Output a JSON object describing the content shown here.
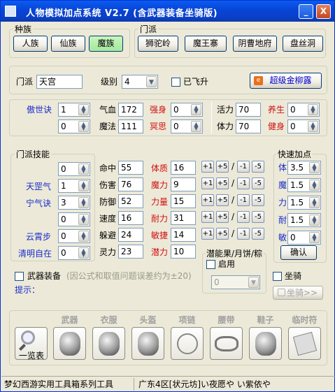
{
  "window": {
    "title": "人物模拟加点系统 V2.7 (含武器装备坐骑版)",
    "min_label": "_",
    "close_label": "X"
  },
  "race": {
    "group_label": "种族",
    "options": [
      "人族",
      "仙族",
      "魔族"
    ],
    "selected": "魔族"
  },
  "sect_top": {
    "group_label": "门派",
    "options": [
      "狮驼岭",
      "魔王寨",
      "阴曹地府",
      "盘丝洞"
    ]
  },
  "info": {
    "sect_label": "门派",
    "sect_value": "天宫",
    "level_label": "级别",
    "level_value": "4",
    "flew_label": "已飞升",
    "super_label": "超级金柳露"
  },
  "skill_top": {
    "name": "傲世诀",
    "value1": "1",
    "value2": "0",
    "arrow": "▲▼"
  },
  "hpmp": {
    "hp_label": "气血",
    "hp_value": "172",
    "mp_label": "魔法",
    "mp_value": "111",
    "strong_label": "强身",
    "strong_value": "0",
    "think_label": "冥思",
    "think_value": "0"
  },
  "vital": {
    "energy_label": "活力",
    "energy_value": "70",
    "stamina_label": "体力",
    "stamina_value": "70",
    "nurture_label": "养生",
    "nurture_value": "0",
    "fitness_label": "健身",
    "fitness_value": "0"
  },
  "sect_skills": {
    "group_label": "门派技能",
    "rows": [
      {
        "name": "",
        "value": "0"
      },
      {
        "name": "天罡气",
        "value": "1"
      },
      {
        "name": "宁气诀",
        "value": "3"
      },
      {
        "name": "",
        "value": "0"
      },
      {
        "name": "云霄步",
        "value": "0"
      },
      {
        "name": "清明自在",
        "value": "0"
      }
    ]
  },
  "stats": {
    "rows": [
      {
        "label": "命中",
        "value": "55",
        "attr": "体质",
        "attr_value": "16"
      },
      {
        "label": "伤害",
        "value": "76",
        "attr": "魔力",
        "attr_value": "9"
      },
      {
        "label": "防御",
        "value": "52",
        "attr": "力量",
        "attr_value": "15"
      },
      {
        "label": "速度",
        "value": "16",
        "attr": "耐力",
        "attr_value": "31"
      },
      {
        "label": "躲避",
        "value": "24",
        "attr": "敏捷",
        "attr_value": "14"
      },
      {
        "label": "灵力",
        "value": "23",
        "attr": "潜力",
        "attr_value": "10"
      }
    ],
    "step_buttons": [
      "+1",
      "+5",
      "-1",
      "-5"
    ],
    "slash": "/"
  },
  "quick_add": {
    "group_label": "快速加点",
    "rows": [
      {
        "label": "体",
        "value": "3.5"
      },
      {
        "label": "魔",
        "value": "1.5"
      },
      {
        "label": "力",
        "value": "1.5"
      },
      {
        "label": "耐",
        "value": "1.5"
      },
      {
        "label": "敏",
        "value": "0"
      }
    ],
    "confirm_label": "确认"
  },
  "potential": {
    "group_label": "潜能果/月饼/粽",
    "enable_label": "启用",
    "value": "0"
  },
  "mount": {
    "label": "坐骑",
    "button_label": "坐骑>>"
  },
  "weapon_equip": {
    "label": "武器装备",
    "note": "(因公式和取值问题误差约为±20)"
  },
  "hint": {
    "label": "提示："
  },
  "equipment": {
    "overview_label": "一览表",
    "slots": [
      "武器",
      "衣服",
      "头盔",
      "项链",
      "腰带",
      "鞋子",
      "临时符"
    ]
  },
  "statusbar": {
    "left": "梦幻西游实用工具箱系列工具",
    "right": "广东4区[状元坊]い夜愿や     い紫依や"
  },
  "colors": {
    "title_bar": "#0a4fd8",
    "selected_green": "#a5e89b",
    "label_blue": "#1a2ccc",
    "label_red": "#d01010"
  }
}
